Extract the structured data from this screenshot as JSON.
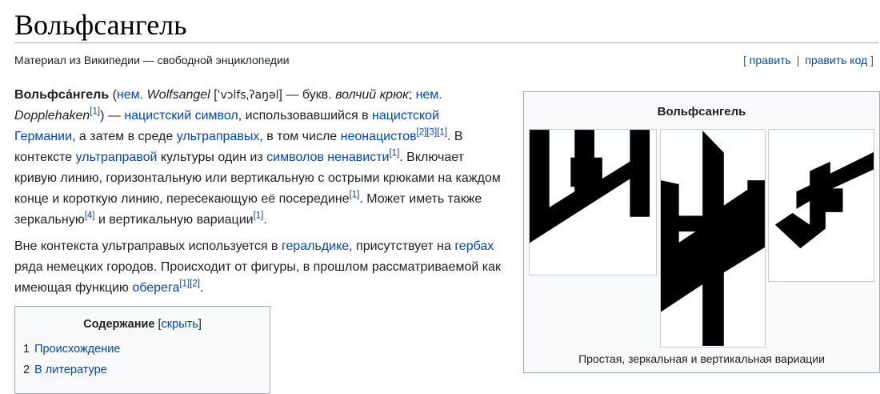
{
  "page": {
    "title": "Вольфсангель",
    "tagline": "Материал из Википедии — свободной энциклопедии"
  },
  "edit": {
    "open_bracket": "[",
    "edit_label": "править",
    "separator": "|",
    "edit_code_label": "править код",
    "close_bracket": "]"
  },
  "article": {
    "p1": {
      "term": "Вольфса́нгель",
      "t1": " (",
      "lang1": "нем.",
      "t2": " ",
      "german1": "Wolfsangel",
      "t3": " [",
      "ipa": "ˈvɔlfsˌʔaŋəl",
      "t4": "] — букв. ",
      "gloss": "волчий крюк",
      "t5": "; ",
      "lang2": "нем.",
      "t6": " ",
      "german2": "Dopplehaken",
      "ref1": "[1]",
      "t7": ") — ",
      "link_nazi_symbol": "нацистский символ",
      "t8": ", использовавшийся в ",
      "link_nazi_germany": "нацистской Германии",
      "t9": ", а затем в среде ",
      "link_far_right": "ультраправых",
      "t10": ", в том числе ",
      "link_neonazis": "неонацистов",
      "ref2": "[2][3][1]",
      "t11": ". В контексте ",
      "link_far_right_culture": "ультраправой",
      "t12": " культуры один из ",
      "link_hate_symbols": "символов ненависти",
      "ref3": "[1]",
      "t13": ". Включает кривую линию, горизонтальную или вертикальную с острыми крюками на каждом конце и короткую линию, пересекающую её посередине",
      "ref4": "[1]",
      "t14": ". Может иметь также зеркальную",
      "ref5": "[4]",
      "t15": " и вертикальную вариации",
      "ref6": "[1]",
      "t16": "."
    },
    "p2": {
      "t1": "Вне контекста ультраправых используется в ",
      "link_heraldry": "геральдике",
      "t2": ", присутствует на ",
      "link_coats": "гербах",
      "t3": " ряда немецких городов. Происходит от фигуры, в прошлом рассматриваемой как имеющая функцию ",
      "link_amulet": "оберега",
      "ref1": "[1][2]",
      "t4": "."
    }
  },
  "toc": {
    "title": "Содержание",
    "hide_open": " [",
    "hide_label": "скрыть",
    "hide_close": "]",
    "items": [
      {
        "num": "1",
        "label": "Происхождение"
      },
      {
        "num": "2",
        "label": "В литературе"
      }
    ]
  },
  "infobox": {
    "title": "Вольфсангель",
    "caption": "Простая, зеркальная и вертикальная вариации"
  }
}
